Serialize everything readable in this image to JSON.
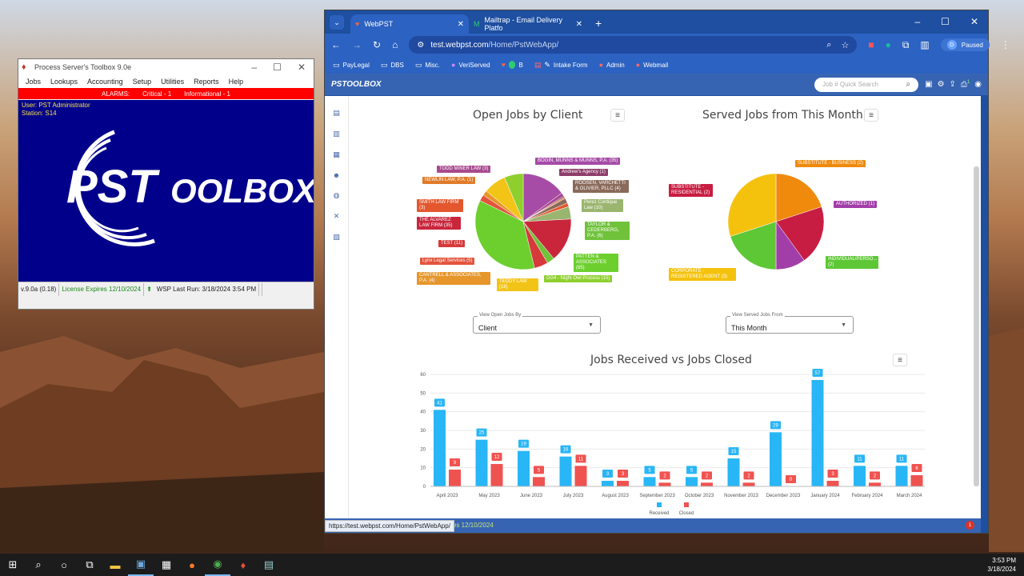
{
  "pst_window": {
    "title": "Process Server's Toolbox 9.0e",
    "menu": [
      "Jobs",
      "Lookups",
      "Accounting",
      "Setup",
      "Utilities",
      "Reports",
      "Help"
    ],
    "alarm": {
      "label": "ALARMS:",
      "critical": "Critical - 1",
      "informational": "Informational - 1"
    },
    "user_line": "User: PST Administrator",
    "station_line": "Station: S14",
    "logo_text": "PSTOOLBOX",
    "status": {
      "version": "v.9.0a (0.18)",
      "license": "License Expires 12/10/2024",
      "wsp": "WSP Last Run: 3/18/2024 3:54 PM"
    }
  },
  "browser": {
    "tabs": [
      {
        "title": "WebPST",
        "active": true
      },
      {
        "title": "Mailtrap - Email Delivery Platfo",
        "active": false
      }
    ],
    "url_host": "test.webpst.com",
    "url_path": "/Home/PstWebApp/",
    "profile_initial": "D",
    "profile_status": "Paused",
    "bookmarks": [
      "PayLegal",
      "DBS",
      "Misc.",
      "VeriServed",
      "B",
      "Intake Form",
      "Admin",
      "Webmail"
    ]
  },
  "app": {
    "brand": "PSTOOLBOX",
    "search_placeholder": "Job # Quick Search",
    "notification_count": "1",
    "open_jobs_title": "Open Jobs by Client",
    "served_jobs_title": "Served Jobs from This Month",
    "open_select": {
      "label": "View Open Jobs By",
      "value": "Client"
    },
    "served_select": {
      "label": "View Served Jobs From",
      "value": "This Month"
    },
    "hover_url": "https://test.webpst.com/Home/PstWebApp/",
    "license_footer": "es 12/10/2024",
    "footer_badge": "1",
    "colors": {
      "header": "#3764b2",
      "received": "#29b6f6",
      "closed": "#ef5350"
    }
  },
  "open_pie_labels": [
    {
      "text": "BOGIN, MUNNS & MUNNS, P.A. (35)",
      "color": "#a64ca6"
    },
    {
      "text": "TODD MINER LAW (3)",
      "color": "#a84a8e"
    },
    {
      "text": "Andrew's Agency (1)",
      "color": "#8e3d6a"
    },
    {
      "text": "NEWLIN LAW, P.A. (1)",
      "color": "#e07b2a"
    },
    {
      "text": "ROOSEN, VARCHETTI & OLIVIER, PLLC (4)",
      "color": "#8a6a5a"
    },
    {
      "text": "SMITH LAW FIRM (3)",
      "color": "#e4572e"
    },
    {
      "text": "Perez Contique Law (10)",
      "color": "#9ab56e"
    },
    {
      "text": "THE ALVAREZ LAW FIRM (35)",
      "color": "#c9263c"
    },
    {
      "text": "TAYLOR & CEDERBERG, P.A. (6)",
      "color": "#6fc23a"
    },
    {
      "text": "TEST (11)",
      "color": "#d63a3a"
    },
    {
      "text": "PATTEN & ASSOCIATES (85)",
      "color": "#6ccf2e"
    },
    {
      "text": "Lynx Legal Services (5)",
      "color": "#e2543c"
    },
    {
      "text": "CANTRELL & ASSOCIATES, P.A. (4)",
      "color": "#e6962a"
    },
    {
      "text": "TEDDY LAW (18)",
      "color": "#f2c418"
    },
    {
      "text": "DG4 - Night Owl Process (15)",
      "color": "#8ecf2e"
    }
  ],
  "served_pie_labels": [
    {
      "text": "SUBSTITUTE - BUSINESS (2)",
      "color": "#ef8a0c"
    },
    {
      "text": "SUBSTITUTE - RESIDENTIAL (2)",
      "color": "#c81d42"
    },
    {
      "text": "AUTHORIZED (1)",
      "color": "#a13ea8"
    },
    {
      "text": "INDIVIDUAL/PERSO... (2)",
      "color": "#5ec735"
    },
    {
      "text": "CORPORATE - REGISTERED AGENT (3)",
      "color": "#f4c20d"
    }
  ],
  "chart_data": {
    "type": "bar",
    "title": "Jobs Received vs Jobs Closed",
    "categories": [
      "April 2023",
      "May 2023",
      "June 2023",
      "July 2023",
      "August 2023",
      "September 2023",
      "October 2023",
      "November 2023",
      "December 2023",
      "January 2024",
      "February 2024",
      "March 2024"
    ],
    "series": [
      {
        "name": "Received",
        "values": [
          41,
          25,
          19,
          16,
          3,
          5,
          5,
          15,
          29,
          57,
          11,
          11
        ]
      },
      {
        "name": "Closed",
        "values": [
          9,
          12,
          5,
          11,
          3,
          2,
          2,
          2,
          0,
          3,
          2,
          6
        ]
      }
    ],
    "ylim": [
      0,
      60
    ],
    "yticks": [
      0,
      10,
      20,
      30,
      40,
      50,
      60
    ],
    "grid": true,
    "legend": "bottom"
  },
  "taskbar": {
    "time": "3:53 PM",
    "date": "3/18/2024"
  }
}
